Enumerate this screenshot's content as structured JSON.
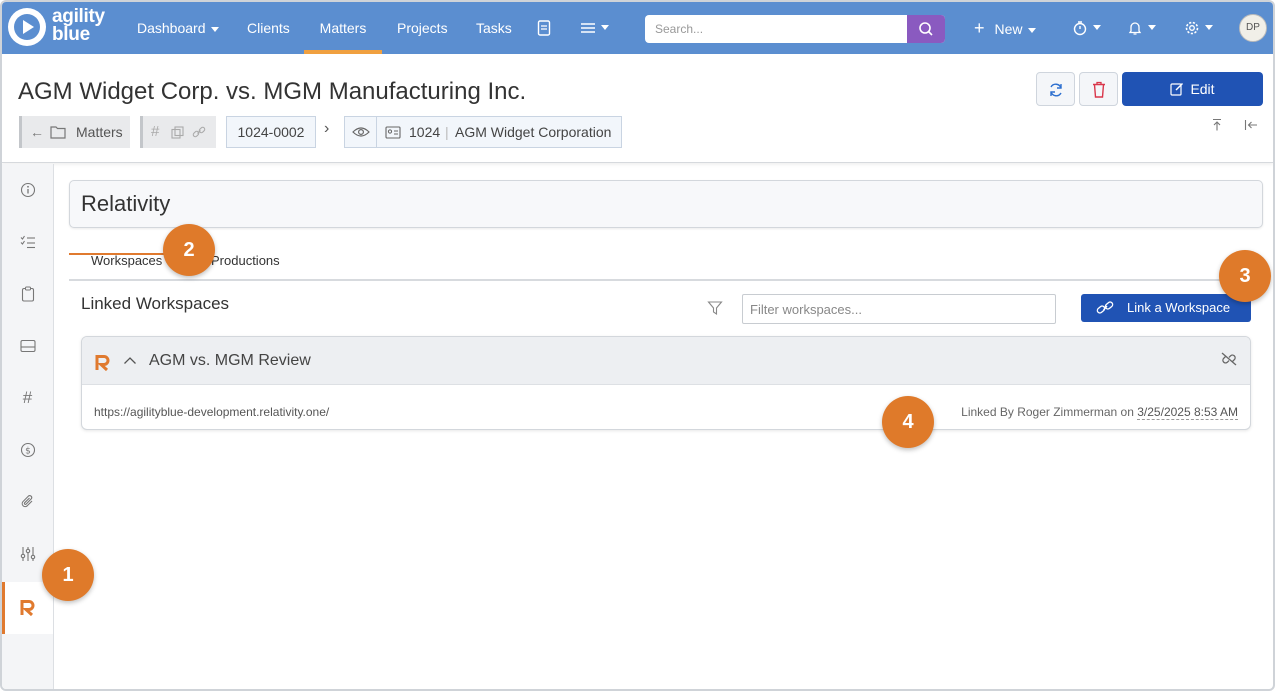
{
  "nav": {
    "logo_line1": "agility",
    "logo_line2": "blue",
    "dashboard": "Dashboard",
    "clients": "Clients",
    "matters": "Matters",
    "projects": "Projects",
    "tasks": "Tasks",
    "search_placeholder": "Search...",
    "new_label": "New",
    "avatar_initials": "DP",
    "accent_color": "#5b8ed0",
    "search_button_color": "#8a5ac0"
  },
  "header": {
    "title": "AGM Widget Corp. vs. MGM Manufacturing Inc.",
    "crumb_matters": "Matters",
    "matter_number": "1024-0002",
    "client_number": "1024",
    "client_name": "AGM Widget Corporation",
    "edit_label": "Edit",
    "edit_color": "#2053b4"
  },
  "main": {
    "section_title": "Relativity",
    "tabs": [
      {
        "label": "Workspaces"
      },
      {
        "label": "Productions"
      }
    ],
    "subtitle": "Linked Workspaces",
    "filter_placeholder": "Filter workspaces...",
    "link_button": "Link a Workspace",
    "workspace": {
      "name": "AGM vs. MGM Review",
      "url": "https://agilityblue-development.relativity.one/",
      "linked_prefix": "Linked By Roger Zimmerman on",
      "linked_date": "3/25/2025 8:53 AM"
    }
  },
  "callouts": [
    "1",
    "2",
    "3",
    "4"
  ],
  "callout_color": "#df7a2a"
}
